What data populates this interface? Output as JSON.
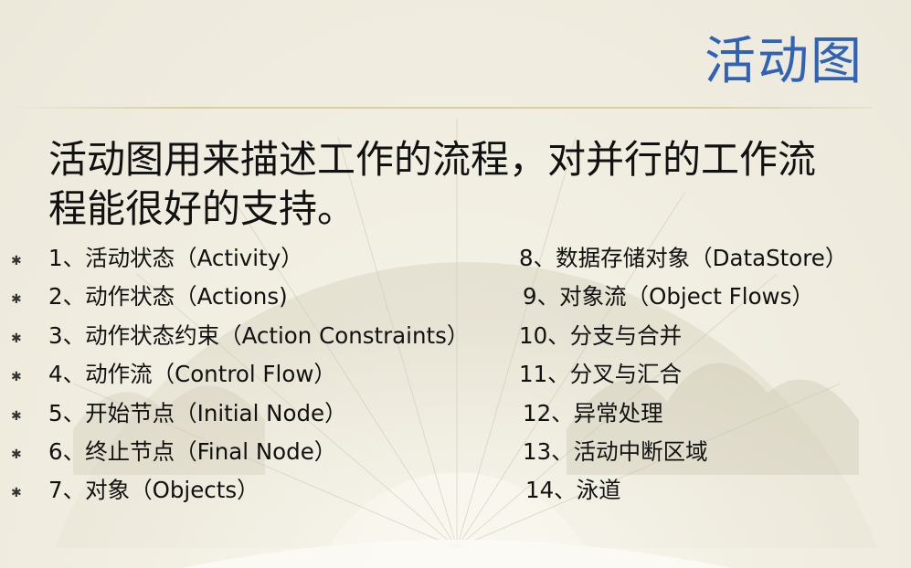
{
  "slide": {
    "title": "活动图",
    "intro_line1": "活动图用来描述工作的流程，对并行的工作流",
    "intro_line2": "程能很好的支持。",
    "bullet_glyph": "✱",
    "left_items": [
      "1、活动状态（Activity）",
      "2、动作状态（Actions)",
      "3、动作状态约束（Action Constraints）",
      "4、动作流（Control Flow）",
      "5、开始节点（Initial Node）",
      "6、终止节点（Final Node）",
      "7、对象（Objects）"
    ],
    "right_items": [
      "8、数据存储对象（DataStore）",
      "9、对象流（Object Flows）",
      "10、分支与合并",
      "11、分叉与汇合",
      "12、异常处理",
      "13、活动中断区域",
      "14、泳道"
    ],
    "colors": {
      "title": "#2f63b8",
      "text": "#111111",
      "divider": "#d8cfa0"
    }
  }
}
